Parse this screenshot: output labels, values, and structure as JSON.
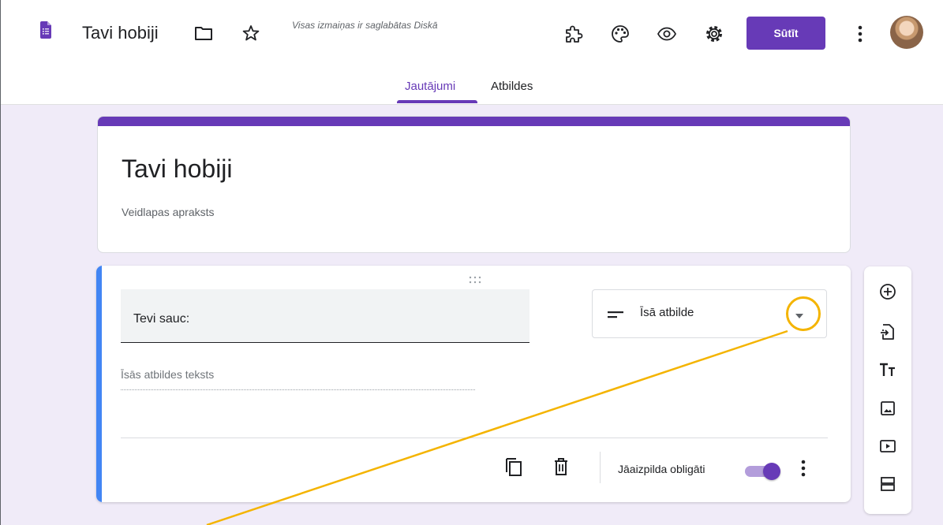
{
  "header": {
    "doc_title": "Tavi hobiji",
    "save_status": "Visas izmaiņas ir saglabātas Diskā",
    "send_label": "Sūtīt",
    "icons": {
      "app": "forms-icon",
      "folder": "folder-icon",
      "star": "star-icon",
      "addons": "puzzle-icon",
      "palette": "palette-icon",
      "preview": "eye-icon",
      "settings": "gear-icon",
      "more": "more-vert-icon"
    }
  },
  "tabs": [
    {
      "label": "Jautājumi",
      "active": true
    },
    {
      "label": "Atbildes",
      "active": false
    }
  ],
  "form": {
    "title": "Tavi hobiji",
    "description": "Veidlapas apraksts"
  },
  "question": {
    "text": "Tevi sauc:",
    "type_label": "Īsā atbilde",
    "answer_placeholder": "Īsās atbildes teksts",
    "required_label": "Jāaizpilda obligāti",
    "required": true
  },
  "side_toolbar": [
    "add-question-icon",
    "import-questions-icon",
    "add-title-icon",
    "add-image-icon",
    "add-video-icon",
    "add-section-icon"
  ],
  "colors": {
    "brand": "#673ab7",
    "background": "#f0ebf8",
    "question_accent": "#4285f4",
    "annotation": "#f4b400"
  }
}
